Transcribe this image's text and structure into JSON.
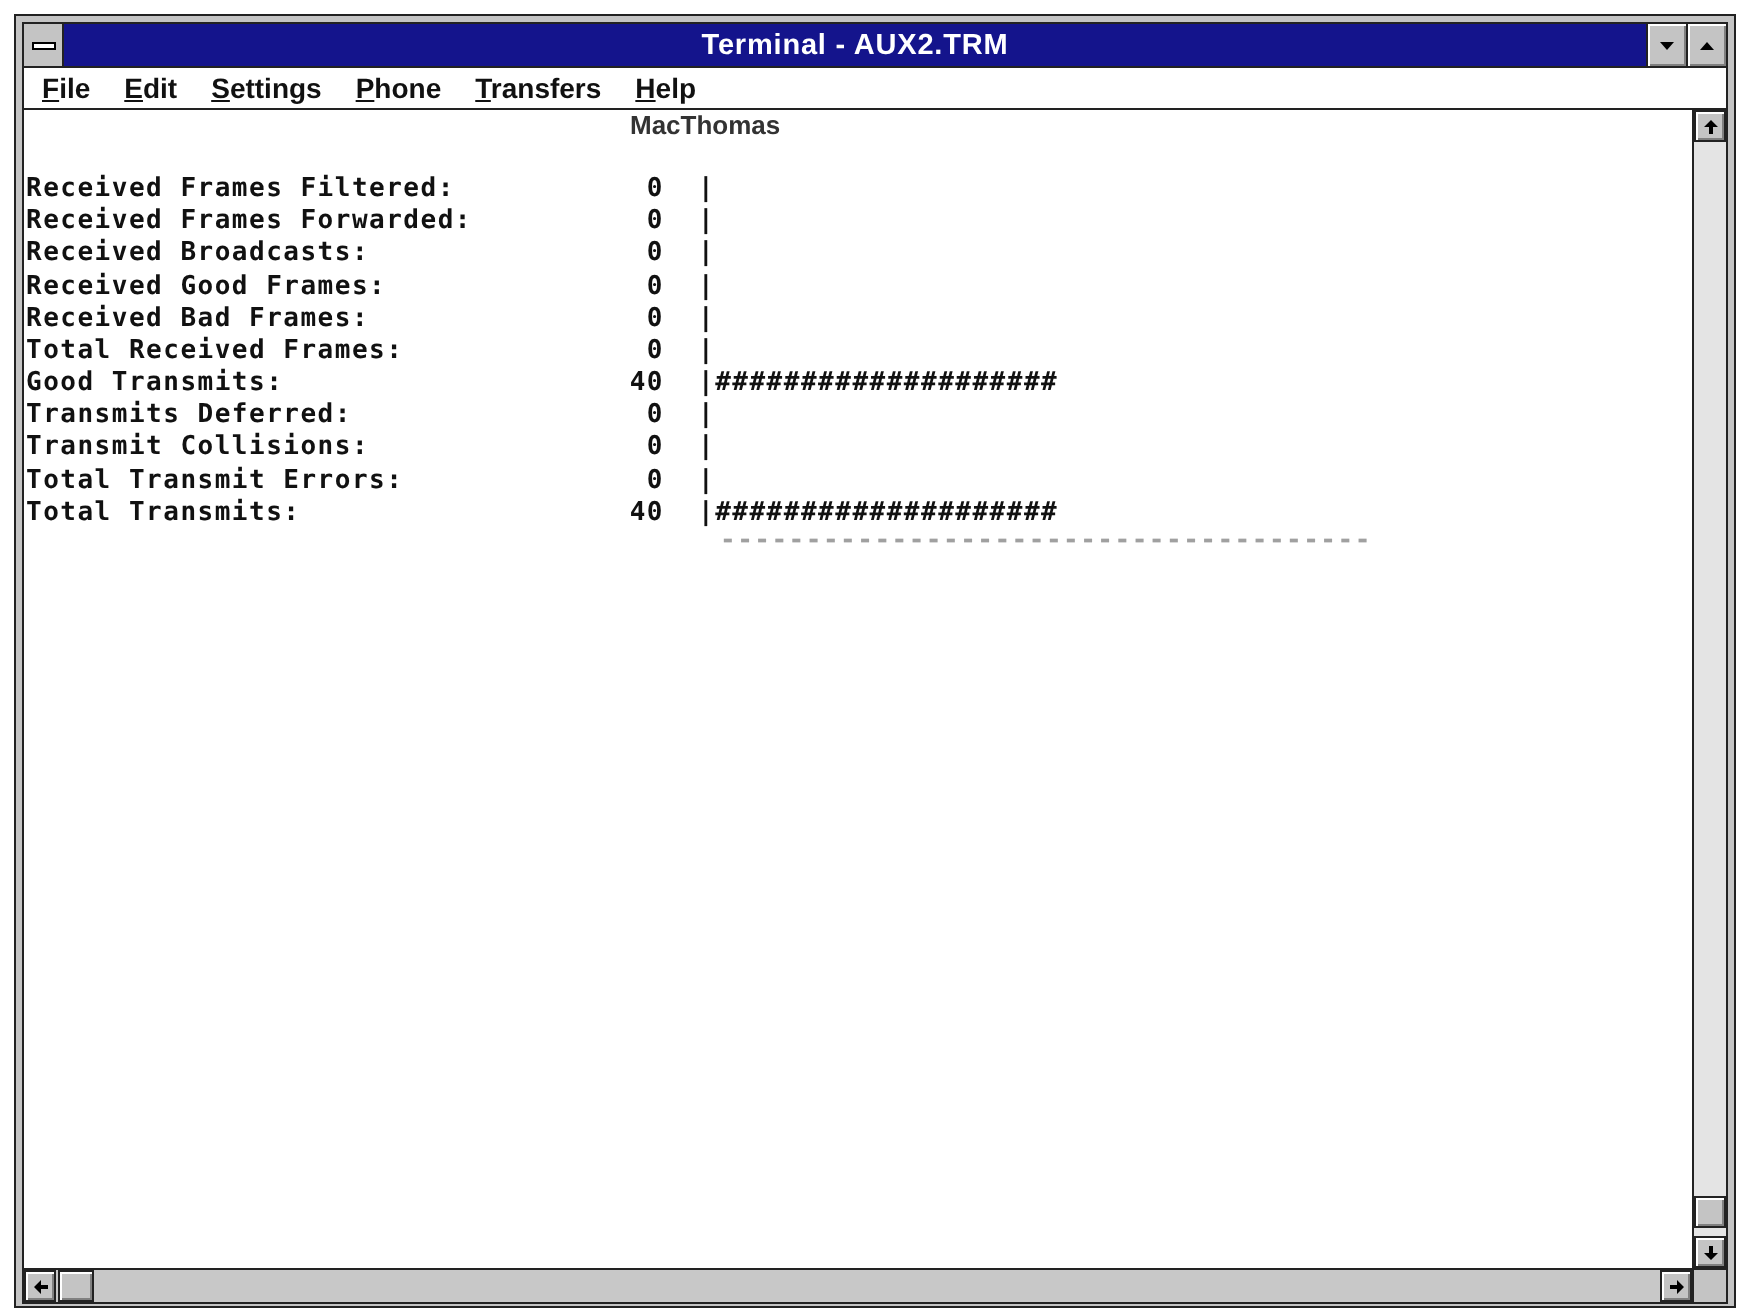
{
  "window": {
    "title": "Terminal - AUX2.TRM"
  },
  "menu_bar": [
    "File",
    "Edit",
    "Settings",
    "Phone",
    "Transfers",
    "Help"
  ],
  "terminal": {
    "header": "MacThomas",
    "rows": [
      {
        "label": "Received Frames Filtered:",
        "value": "0",
        "bar": "|"
      },
      {
        "label": "Received Frames Forwarded:",
        "value": "0",
        "bar": "|"
      },
      {
        "label": "Received Broadcasts:",
        "value": "0",
        "bar": "|"
      },
      {
        "label": "Received Good Frames:",
        "value": "0",
        "bar": "|"
      },
      {
        "label": "Received Bad Frames:",
        "value": "0",
        "bar": "|"
      },
      {
        "label": "Total Received Frames:",
        "value": "0",
        "bar": "|"
      },
      {
        "label": "Good Transmits:",
        "value": "40",
        "bar": "|####################"
      },
      {
        "label": "Transmits Deferred:",
        "value": "0",
        "bar": "|"
      },
      {
        "label": "Transmit Collisions:",
        "value": "0",
        "bar": "|"
      },
      {
        "label": "Total Transmit Errors:",
        "value": "0",
        "bar": "|"
      },
      {
        "label": "Total Transmits:",
        "value": "40",
        "bar": "|####################"
      }
    ],
    "rule": "--------------------------------------"
  }
}
